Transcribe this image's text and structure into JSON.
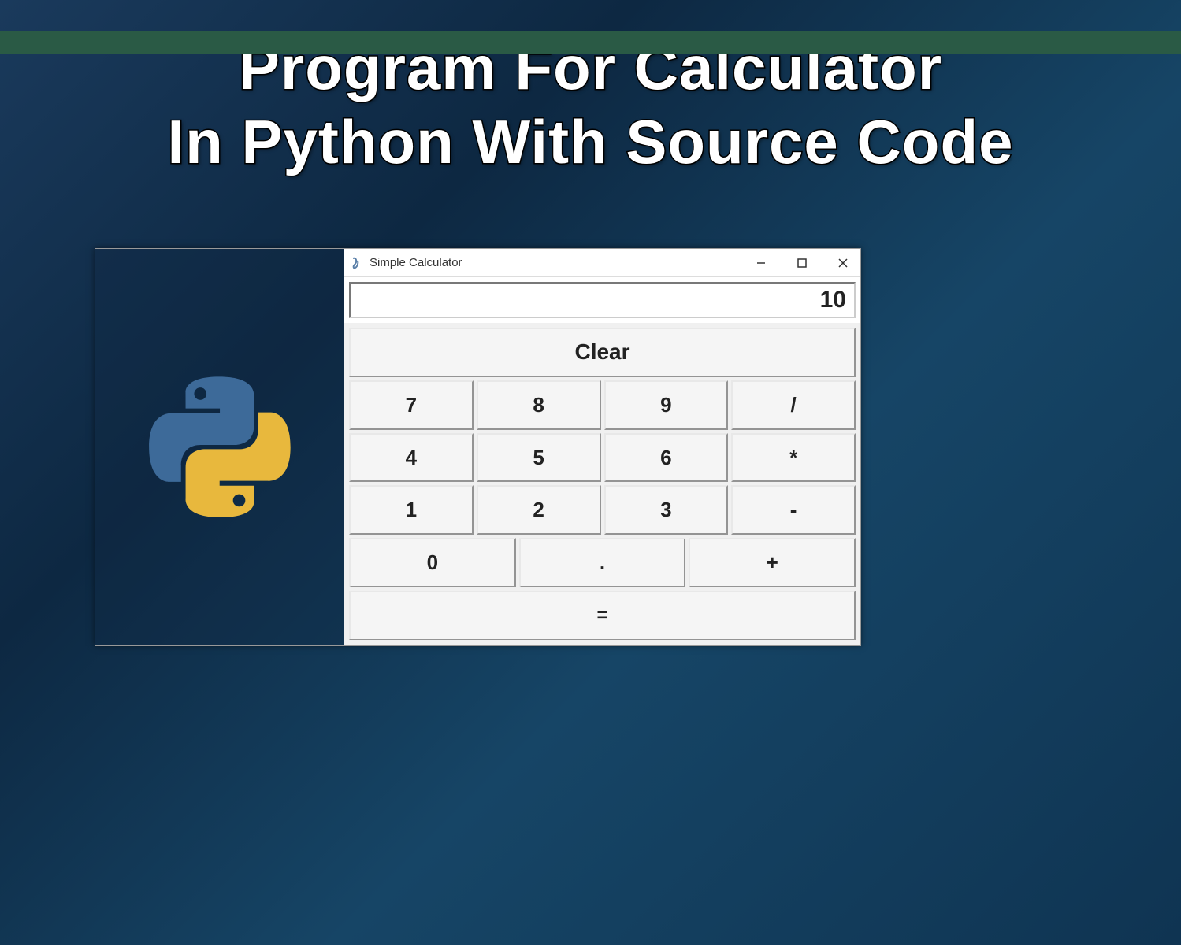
{
  "title": {
    "line1": "Program For Calculator",
    "line2": "In Python With Source Code"
  },
  "calculator": {
    "window_title": "Simple Calculator",
    "display_value": "10",
    "clear_label": "Clear",
    "buttons": {
      "row1": [
        "7",
        "8",
        "9",
        "/"
      ],
      "row2": [
        "4",
        "5",
        "6",
        "*"
      ],
      "row3": [
        "1",
        "2",
        "3",
        "-"
      ],
      "row4": [
        "0",
        ".",
        "+"
      ],
      "equals": "="
    }
  }
}
